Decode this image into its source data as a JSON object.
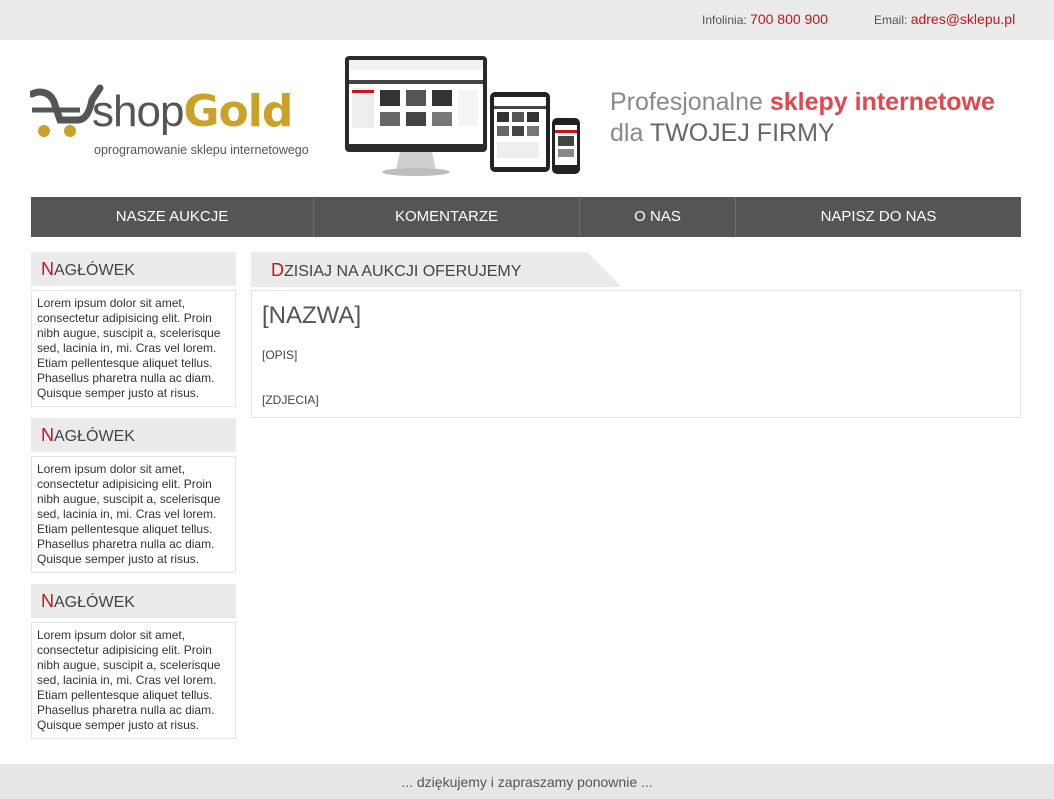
{
  "topbar": {
    "phone_label": "Infolinia:",
    "phone_value": "700 800 900",
    "email_label": "Email:",
    "email_value": "adres@sklepu.pl"
  },
  "logo": {
    "shop": "shop",
    "gold": "Gold",
    "tagline": "oprogramowanie sklepu internetowego"
  },
  "slogan": {
    "line1_a": "Profesjonalne ",
    "line1_b": "sklepy internetowe",
    "line2_a": "dla ",
    "line2_b": "TWOJEJ FIRMY"
  },
  "nav": {
    "items": [
      {
        "label": "NASZE AUKCJE"
      },
      {
        "label": "KOMENTARZE"
      },
      {
        "label": "O NAS"
      },
      {
        "label": "NAPISZ DO NAS"
      }
    ]
  },
  "sidebar": {
    "boxes": [
      {
        "head_first": "N",
        "head_rest": "AGŁÓWEK",
        "text": "Lorem ipsum dolor sit amet, consectetur adipisicing elit. Proin nibh augue, suscipit a, scelerisque sed, lacinia in, mi. Cras vel lorem. Etiam pellentesque aliquet tellus. Phasellus pharetra nulla ac diam. Quisque semper justo at risus."
      },
      {
        "head_first": "N",
        "head_rest": "AGŁÓWEK",
        "text": "Lorem ipsum dolor sit amet, consectetur adipisicing elit. Proin nibh augue, suscipit a, scelerisque sed, lacinia in, mi. Cras vel lorem. Etiam pellentesque aliquet tellus. Phasellus pharetra nulla ac diam. Quisque semper justo at risus."
      },
      {
        "head_first": "N",
        "head_rest": "AGŁÓWEK",
        "text": "Lorem ipsum dolor sit amet, consectetur adipisicing elit. Proin nibh augue, suscipit a, scelerisque sed, lacinia in, mi. Cras vel lorem. Etiam pellentesque aliquet tellus. Phasellus pharetra nulla ac diam. Quisque semper justo at risus."
      }
    ]
  },
  "main": {
    "head_first": "D",
    "head_rest": "ZISIAJ NA AUKCJI OFERUJEMY",
    "title": "[NAZWA]",
    "desc": "[OPIS]",
    "pics": "[ZDJECIA]"
  },
  "footer": {
    "text": "... dziękujemy i zapraszamy ponownie ..."
  },
  "colors": {
    "accent": "#c8141a",
    "nav_bg": "#555555",
    "gold": "#c9a227",
    "slogan_highlight": "#e3474d"
  }
}
